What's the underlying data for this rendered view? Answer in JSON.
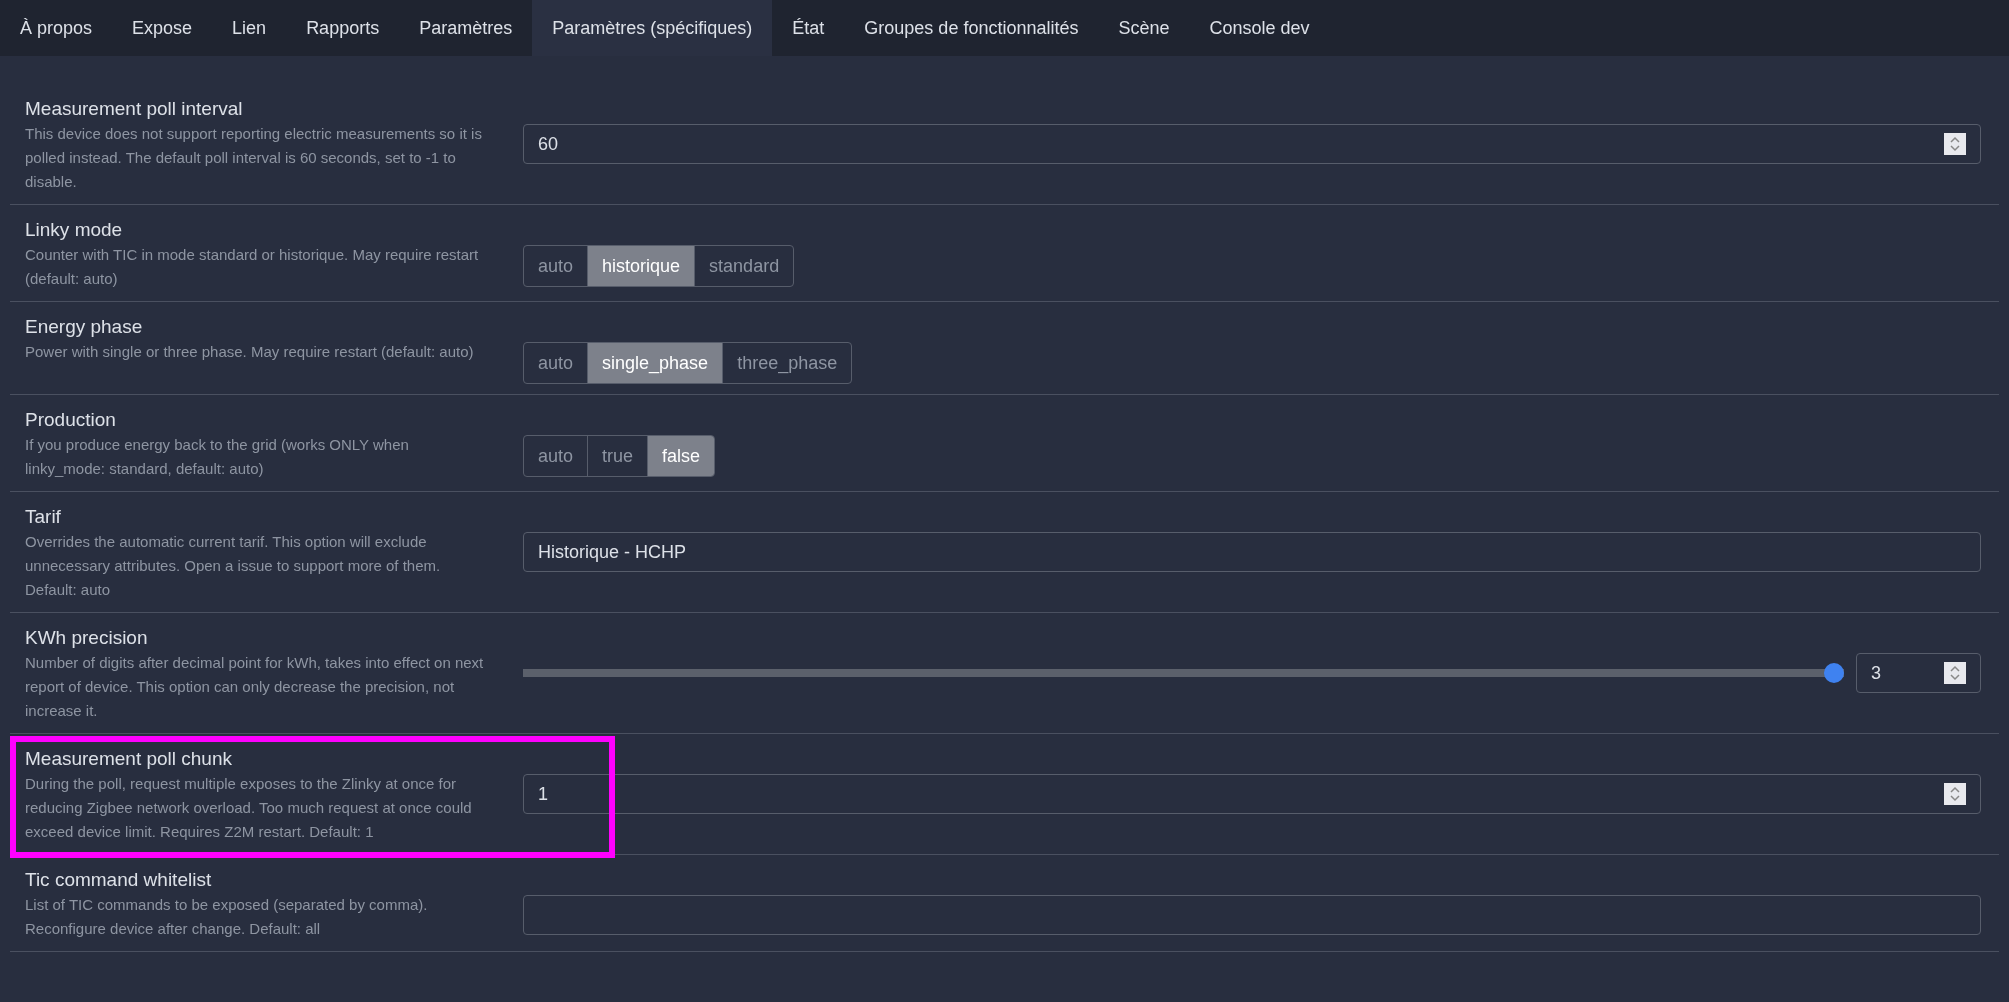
{
  "tabs": [
    {
      "label": "À propos",
      "selected": false
    },
    {
      "label": "Expose",
      "selected": false
    },
    {
      "label": "Lien",
      "selected": false
    },
    {
      "label": "Rapports",
      "selected": false
    },
    {
      "label": "Paramètres",
      "selected": false
    },
    {
      "label": "Paramètres (spécifiques)",
      "selected": true
    },
    {
      "label": "État",
      "selected": false
    },
    {
      "label": "Groupes de fonctionnalités",
      "selected": false
    },
    {
      "label": "Scène",
      "selected": false
    },
    {
      "label": "Console dev",
      "selected": false
    }
  ],
  "settings": [
    {
      "kind": "number",
      "title": "Measurement poll interval",
      "description": "This device does not support reporting electric measurements so it is polled instead. The default poll interval is 60 seconds, set to -1 to disable.",
      "value": "60",
      "highlighted": false
    },
    {
      "kind": "choice",
      "title": "Linky mode",
      "description": "Counter with TIC in mode standard or historique. May require restart (default: auto)",
      "options": [
        {
          "label": "auto",
          "selected": false
        },
        {
          "label": "historique",
          "selected": true
        },
        {
          "label": "standard",
          "selected": false
        }
      ],
      "highlighted": false
    },
    {
      "kind": "choice",
      "title": "Energy phase",
      "description": "Power with single or three phase. May require restart (default: auto)",
      "options": [
        {
          "label": "auto",
          "selected": false
        },
        {
          "label": "single_phase",
          "selected": true
        },
        {
          "label": "three_phase",
          "selected": false
        }
      ],
      "highlighted": false
    },
    {
      "kind": "choice",
      "title": "Production",
      "description": "If you produce energy back to the grid (works ONLY when linky_mode: standard, default: auto)",
      "options": [
        {
          "label": "auto",
          "selected": false
        },
        {
          "label": "true",
          "selected": false
        },
        {
          "label": "false",
          "selected": true
        }
      ],
      "highlighted": false
    },
    {
      "kind": "text",
      "title": "Tarif",
      "description": "Overrides the automatic current tarif. This option will exclude unnecessary attributes. Open a issue to support more of them. Default: auto",
      "value": "Historique - HCHP",
      "highlighted": false
    },
    {
      "kind": "slider",
      "title": "KWh precision",
      "description": "Number of digits after decimal point for kWh, takes into effect on next report of device. This option can only decrease the precision, not increase it.",
      "level": 1,
      "value": "3",
      "highlighted": false
    },
    {
      "kind": "number",
      "title": "Measurement poll chunk",
      "description": "During the poll, request multiple exposes to the Zlinky at once for reducing Zigbee network overload. Too much request at once could exceed device limit. Requires Z2M restart. Default: 1",
      "value": "1",
      "highlighted": true
    },
    {
      "kind": "text",
      "title": "Tic command whitelist",
      "description": "List of TIC commands to be exposed (separated by comma). Reconfigure device after change. Default: all",
      "highlighted": false
    }
  ]
}
